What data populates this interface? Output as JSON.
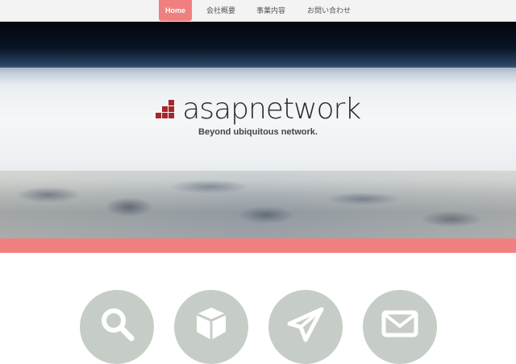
{
  "nav": {
    "items": [
      {
        "label": "Home",
        "active": true
      },
      {
        "label": "会社概要",
        "active": false
      },
      {
        "label": "事業内容",
        "active": false
      },
      {
        "label": "お問い合わせ",
        "active": false
      }
    ],
    "active_color": "#f08080"
  },
  "hero": {
    "brand": "asapnetwork",
    "tagline": "Beyond ubiquitous network.",
    "logo_color": "#a8262b"
  },
  "services": {
    "icons": [
      "search-icon",
      "box-icon",
      "paper-plane-icon",
      "mail-icon"
    ],
    "circle_color": "#c6cdc6"
  }
}
